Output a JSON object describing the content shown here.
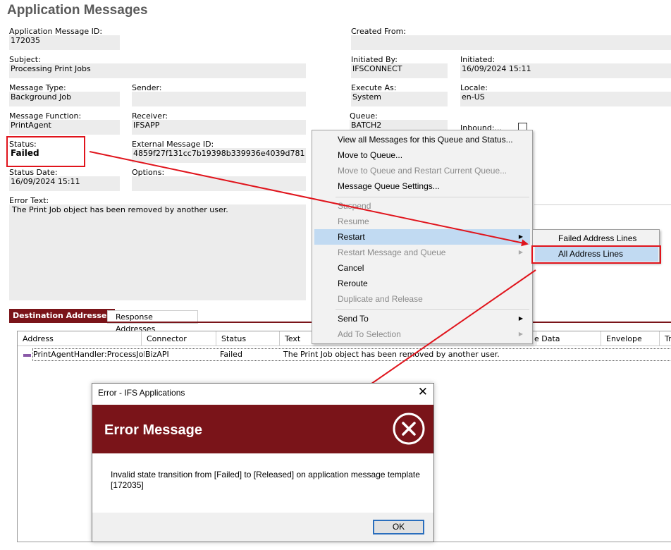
{
  "page": {
    "title": "Application Messages"
  },
  "form": {
    "app_msg_id_label": "Application Message ID:",
    "app_msg_id_value": "172035",
    "created_from_label": "Created From:",
    "created_from_value": "",
    "subject_label": "Subject:",
    "subject_value": "Processing Print Jobs",
    "initiated_by_label": "Initiated By:",
    "initiated_by_value": "IFSCONNECT",
    "initiated_label": "Initiated:",
    "initiated_value": "16/09/2024 15:11",
    "message_type_label": "Message Type:",
    "message_type_value": "Background Job",
    "sender_label": "Sender:",
    "sender_value": "",
    "execute_as_label": "Execute As:",
    "execute_as_value": "System",
    "locale_label": "Locale:",
    "locale_value": "en-US",
    "message_function_label": "Message Function:",
    "message_function_value": "PrintAgent",
    "receiver_label": "Receiver:",
    "receiver_value": "IFSAPP",
    "queue_label": "Queue:",
    "queue_value": "BATCH2",
    "inbound_label": "Inbound:...",
    "inbound_checked": false,
    "status_label": "Status:",
    "status_value": "Failed",
    "external_msg_id_label": "External Message ID:",
    "external_msg_id_value": "4859f27f131cc7b19398b339936e4039d781",
    "status_date_label": "Status Date:",
    "status_date_value": "16/09/2024 15:11",
    "options_label": "Options:",
    "options_value": "",
    "error_text_label": "Error Text:",
    "error_text_value": "The Print Job object has been removed by another user."
  },
  "tabs": [
    {
      "label": "Destination Addresses",
      "active": true
    },
    {
      "label": "Response Addresses",
      "active": false
    }
  ],
  "grid": {
    "columns": [
      "Address",
      "Connector",
      "Status",
      "Text",
      "e Data",
      "Envelope",
      "Tr"
    ],
    "rows": [
      {
        "address": "PrintAgentHandler:ProcessJob:",
        "connector": "BizAPI",
        "status": "Failed",
        "text": "The Print Job object has been removed by another user."
      }
    ]
  },
  "context_menu": {
    "items": [
      {
        "label": "View all Messages for this Queue and Status...",
        "disabled": false
      },
      {
        "label": "Move to Queue...",
        "disabled": false
      },
      {
        "label": "Move to Queue and Restart Current Queue...",
        "disabled": true
      },
      {
        "label": "Message Queue Settings...",
        "disabled": false
      },
      {
        "label": "Suspend",
        "disabled": true
      },
      {
        "label": "Resume",
        "disabled": true
      },
      {
        "label": "Restart",
        "disabled": false
      },
      {
        "label": "Restart Message and Queue",
        "disabled": true
      },
      {
        "label": "Cancel",
        "disabled": false
      },
      {
        "label": "Reroute",
        "disabled": false
      },
      {
        "label": "Duplicate and Release",
        "disabled": true
      },
      {
        "label": "Send To",
        "disabled": false
      },
      {
        "label": "Add To Selection",
        "disabled": true
      }
    ],
    "arrow_glyph": "▶"
  },
  "submenu": {
    "items": [
      {
        "label": "Failed Address Lines"
      },
      {
        "label": "All Address Lines"
      }
    ]
  },
  "dialog": {
    "title": "Error - IFS Applications",
    "close_glyph": "✕",
    "heading": "Error Message",
    "message": "Invalid state transition from [Failed] to [Released] on application message template [172035]",
    "ok_label": "OK"
  },
  "colors": {
    "brand_red": "#7a1419",
    "annotation_red": "#e0141c",
    "menu_highlight": "#c1daf2",
    "field_bg": "#ececec"
  }
}
